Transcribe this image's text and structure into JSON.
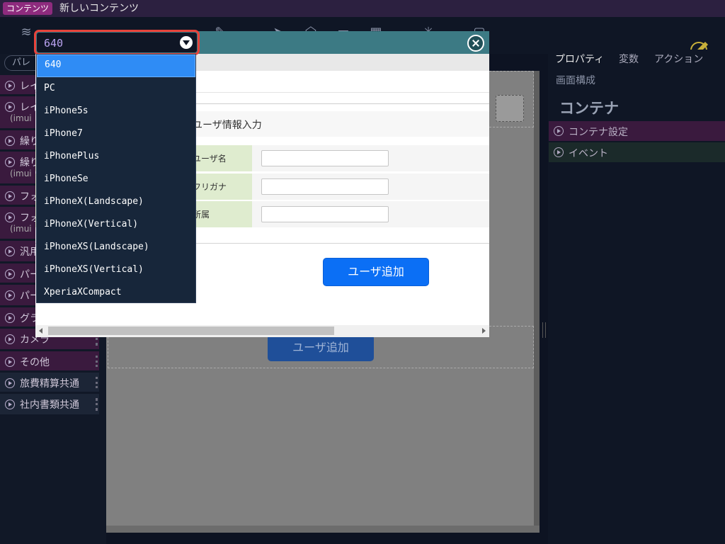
{
  "topbar": {
    "badge": "コンテンツ",
    "title": "新しいコンテンツ"
  },
  "palette": {
    "search_placeholder": "パレ",
    "items": [
      {
        "label": "レイ",
        "sub": "",
        "variant": "pink"
      },
      {
        "label": "レイ",
        "sub": "(imui",
        "variant": "pink"
      },
      {
        "label": "繰り",
        "sub": "",
        "variant": "pink"
      },
      {
        "label": "繰り",
        "sub": "(imui",
        "variant": "pink"
      },
      {
        "label": "フォ",
        "sub": "",
        "variant": "pink"
      },
      {
        "label": "フォ",
        "sub": "(imui",
        "variant": "pink"
      },
      {
        "label": "汎用",
        "sub": "",
        "variant": "pink"
      },
      {
        "label": "パー",
        "sub": "",
        "variant": "pink"
      },
      {
        "label": "パー",
        "sub": "",
        "variant": "pink"
      },
      {
        "label": "グラ",
        "sub": "",
        "variant": "pink"
      },
      {
        "label": "カメラ",
        "sub": "",
        "variant": "pink"
      },
      {
        "label": "その他",
        "sub": "",
        "variant": "pink"
      },
      {
        "label": "旅費精算共通",
        "sub": "",
        "variant": "blue"
      },
      {
        "label": "社内書類共通",
        "sub": "",
        "variant": "blue"
      }
    ]
  },
  "canvas": {
    "bg_button": "ユーザ追加"
  },
  "rightpanel": {
    "tabs": [
      "プロパティ",
      "変数",
      "アクション"
    ],
    "screen_tab": "画面構成",
    "heading": "コンテナ",
    "accordions": [
      "コンテナ設定",
      "イベント"
    ]
  },
  "modal": {
    "form_title": "ユーザ情報入力",
    "fields": [
      {
        "label": "ユーザ名",
        "value": ""
      },
      {
        "label": "フリガナ",
        "value": ""
      },
      {
        "label": "所属",
        "value": ""
      }
    ],
    "add_button": "ユーザ追加"
  },
  "device_select": {
    "selected": "640",
    "options": [
      "640",
      "PC",
      "iPhone5s",
      "iPhone7",
      "iPhonePlus",
      "iPhoneSe",
      "iPhoneX(Landscape)",
      "iPhoneX(Vertical)",
      "iPhoneXS(Landscape)",
      "iPhoneXS(Vertical)",
      "XperiaXCompact"
    ]
  },
  "colors": {
    "accent_select_border": "#e8423a",
    "primary_button": "#0b6ff5",
    "modal_header": "#3c7a84",
    "label_bg": "#dfeccf"
  }
}
